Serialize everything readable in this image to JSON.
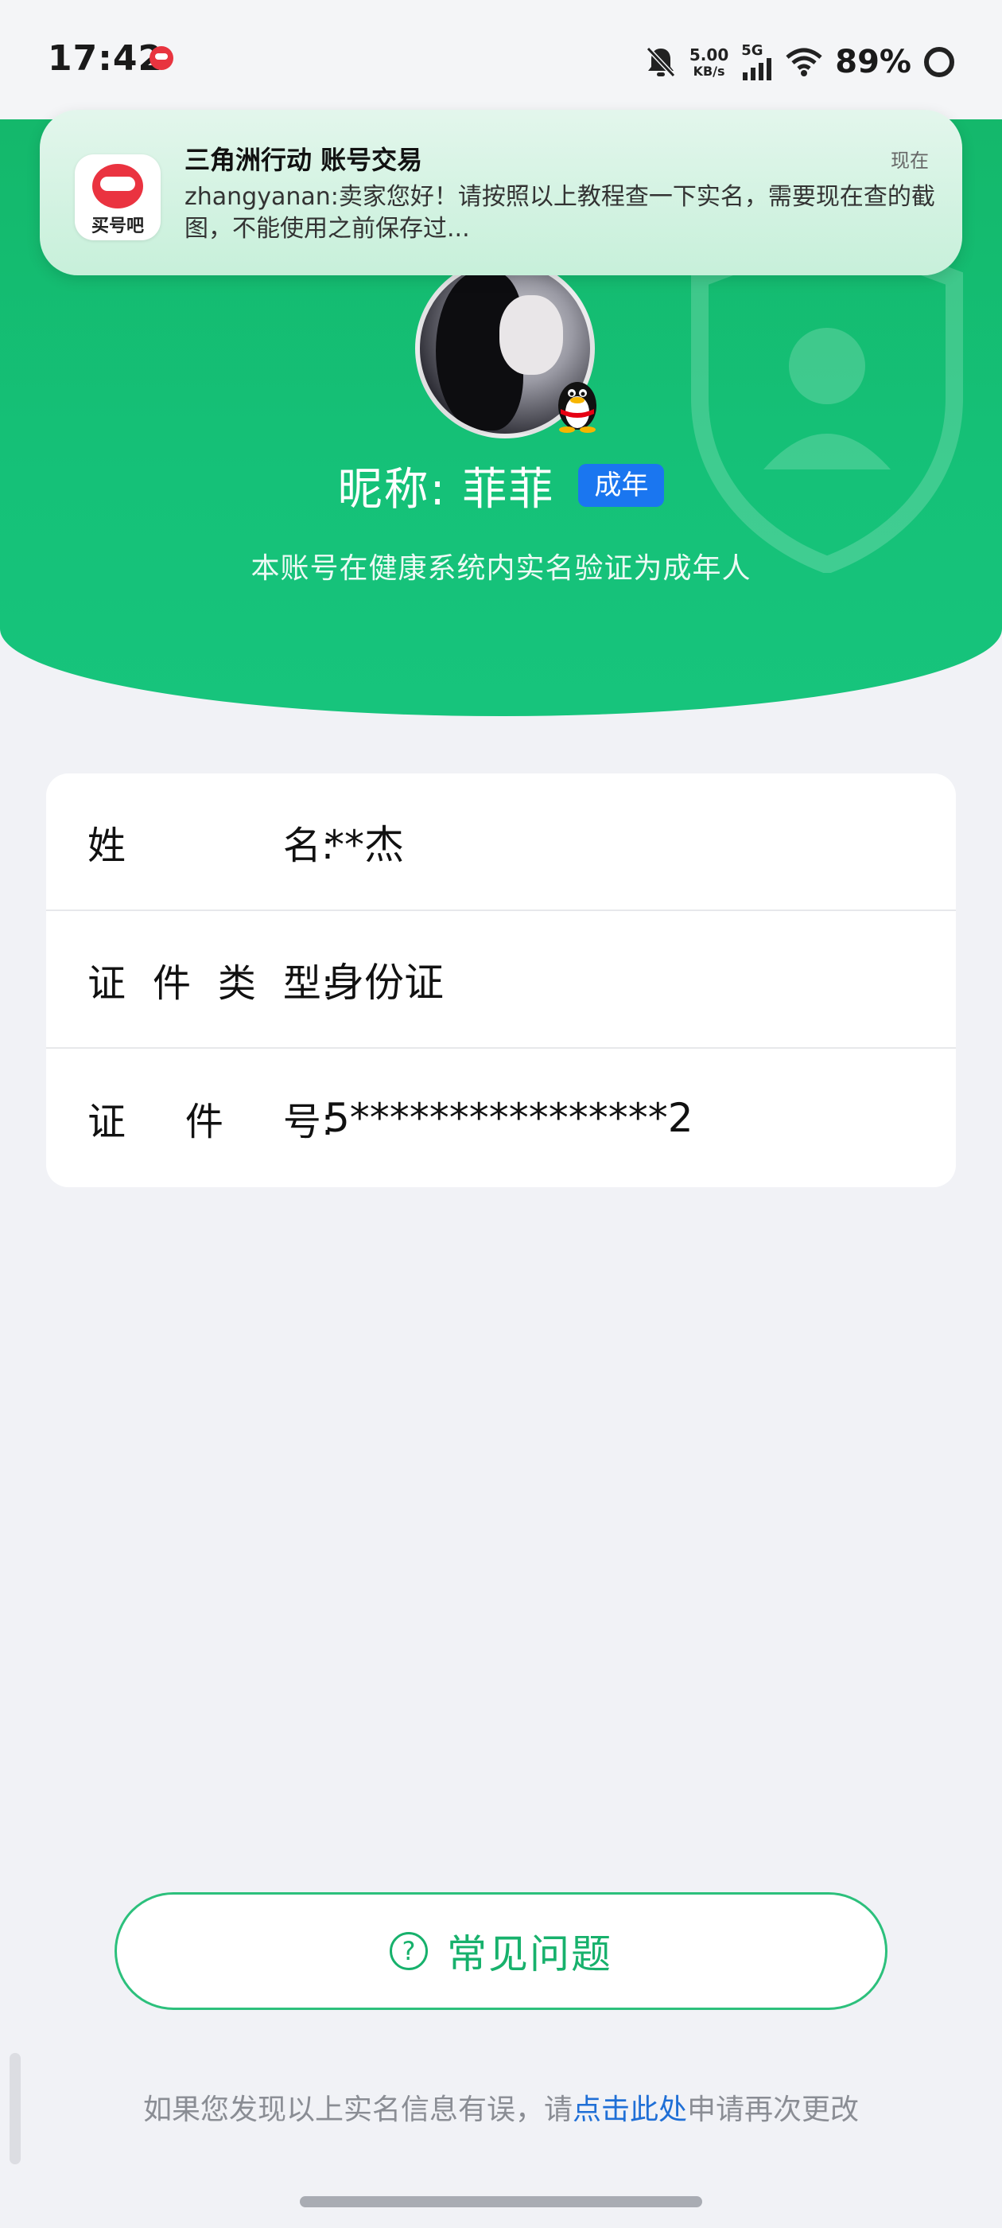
{
  "status_bar": {
    "time": "17:42",
    "net_speed_value": "5.00",
    "net_speed_unit": "KB/s",
    "network_type": "5G",
    "battery": "89%",
    "icons": [
      "mute-bell-icon",
      "signal-icon",
      "wifi-icon",
      "battery-ring-icon"
    ]
  },
  "notification": {
    "app_name_icon_text": "买号吧",
    "title": "三角洲行动 账号交易",
    "time": "现在",
    "body": "zhangyanan:卖家您好！请按照以上教程查一下实名，需要现在查的截图，不能使用之前保存过..."
  },
  "profile": {
    "nickname": "昵称:  菲菲",
    "age_badge": "成年",
    "verify_note": "本账号在健康系统内实名验证为成年人"
  },
  "info": {
    "rows": [
      {
        "label": [
          "姓",
          "名:"
        ],
        "value": "**杰"
      },
      {
        "label": [
          "证",
          "件",
          "类",
          "型:"
        ],
        "value": "身份证"
      },
      {
        "label": [
          "证",
          "件",
          "号:"
        ],
        "value": "5****************2"
      }
    ]
  },
  "faq": {
    "icon": "question-circle-icon",
    "label": "常见问题"
  },
  "footer": {
    "text_before": "如果您发现以上实名信息有误，请",
    "link": "点击此处",
    "text_after": "申请再次更改"
  },
  "colors": {
    "brand_green": "#15c178",
    "badge_blue": "#1a76f0",
    "link_blue": "#1f6fd6"
  }
}
